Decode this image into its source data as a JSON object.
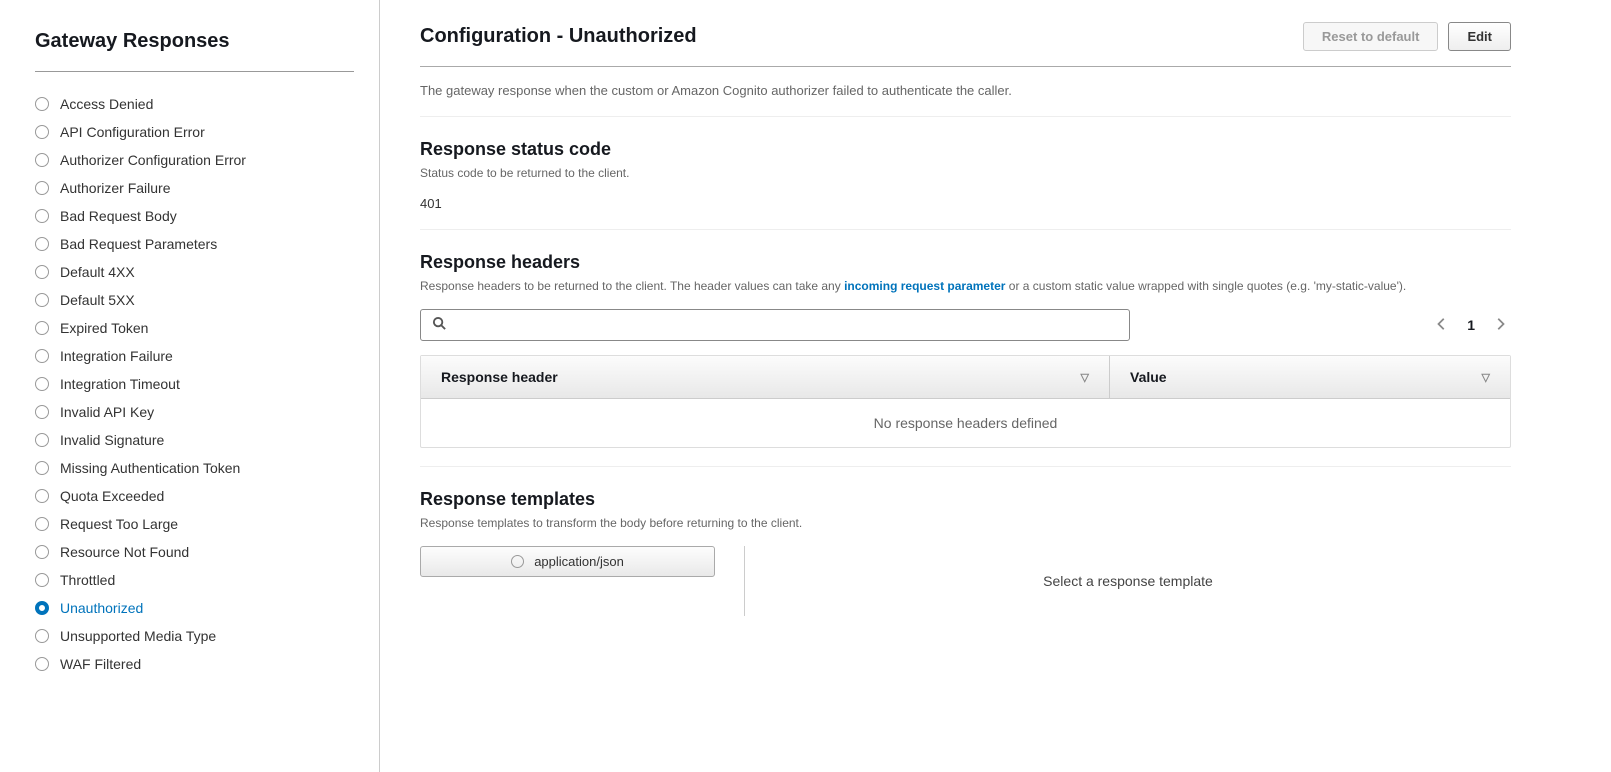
{
  "sidebar": {
    "title": "Gateway Responses",
    "items": [
      {
        "label": "Access Denied",
        "selected": false
      },
      {
        "label": "API Configuration Error",
        "selected": false
      },
      {
        "label": "Authorizer Configuration Error",
        "selected": false
      },
      {
        "label": "Authorizer Failure",
        "selected": false
      },
      {
        "label": "Bad Request Body",
        "selected": false
      },
      {
        "label": "Bad Request Parameters",
        "selected": false
      },
      {
        "label": "Default 4XX",
        "selected": false
      },
      {
        "label": "Default 5XX",
        "selected": false
      },
      {
        "label": "Expired Token",
        "selected": false
      },
      {
        "label": "Integration Failure",
        "selected": false
      },
      {
        "label": "Integration Timeout",
        "selected": false
      },
      {
        "label": "Invalid API Key",
        "selected": false
      },
      {
        "label": "Invalid Signature",
        "selected": false
      },
      {
        "label": "Missing Authentication Token",
        "selected": false
      },
      {
        "label": "Quota Exceeded",
        "selected": false
      },
      {
        "label": "Request Too Large",
        "selected": false
      },
      {
        "label": "Resource Not Found",
        "selected": false
      },
      {
        "label": "Throttled",
        "selected": false
      },
      {
        "label": "Unauthorized",
        "selected": true
      },
      {
        "label": "Unsupported Media Type",
        "selected": false
      },
      {
        "label": "WAF Filtered",
        "selected": false
      }
    ]
  },
  "header": {
    "title": "Configuration - Unauthorized",
    "reset_label": "Reset to default",
    "edit_label": "Edit"
  },
  "description": "The gateway response when the custom or Amazon Cognito authorizer failed to authenticate the caller.",
  "status": {
    "title": "Response status code",
    "sub": "Status code to be returned to the client.",
    "value": "401"
  },
  "headers": {
    "title": "Response headers",
    "sub_pre": "Response headers to be returned to the client. The header values can take any ",
    "sub_link": "incoming request parameter",
    "sub_post": " or a custom static value wrapped with single quotes (e.g. 'my-static-value').",
    "search_placeholder": "",
    "page": "1",
    "col1": "Response header",
    "col2": "Value",
    "empty": "No response headers defined"
  },
  "templates": {
    "title": "Response templates",
    "sub": "Response templates to transform the body before returning to the client.",
    "pill": "application/json",
    "placeholder": "Select a response template"
  }
}
